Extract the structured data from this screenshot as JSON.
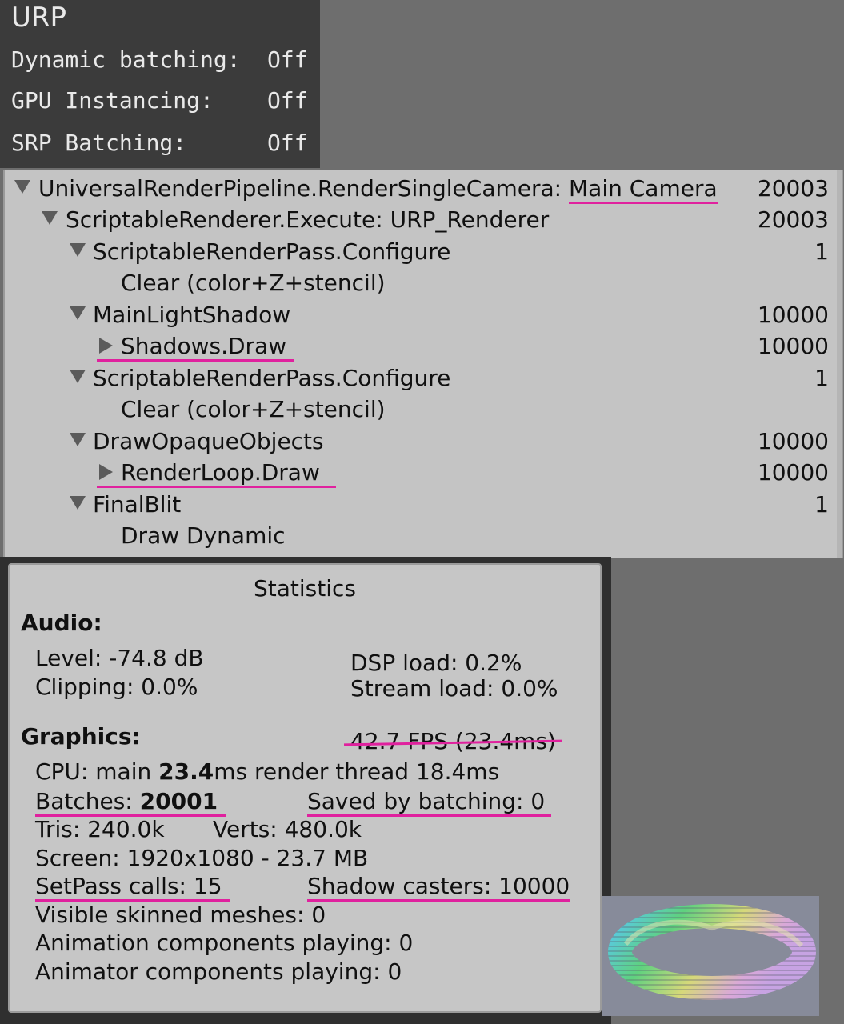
{
  "urp": {
    "title": "URP",
    "rows": [
      {
        "label": "Dynamic batching:",
        "value": "Off"
      },
      {
        "label": "GPU Instancing:",
        "value": "Off"
      },
      {
        "label": "SRP Batching:",
        "value": "Off"
      }
    ]
  },
  "tree": {
    "rows": [
      {
        "arrow": "down",
        "label": "UniversalRenderPipeline.RenderSingleCamera: ",
        "label_hl": "Main Camera",
        "count": "20003"
      },
      {
        "arrow": "down",
        "label": "ScriptableRenderer.Execute: URP_Renderer",
        "count": "20003"
      },
      {
        "arrow": "down",
        "label": "ScriptableRenderPass.Configure",
        "count": "1"
      },
      {
        "arrow": "none",
        "label": "Clear (color+Z+stencil)",
        "count": ""
      },
      {
        "arrow": "down",
        "label": "MainLightShadow",
        "count": "10000"
      },
      {
        "arrow": "right",
        "label": "Shadows.Draw",
        "count": "10000"
      },
      {
        "arrow": "down",
        "label": "ScriptableRenderPass.Configure",
        "count": "1"
      },
      {
        "arrow": "none",
        "label": "Clear (color+Z+stencil)",
        "count": ""
      },
      {
        "arrow": "down",
        "label": "DrawOpaqueObjects",
        "count": "10000"
      },
      {
        "arrow": "right",
        "label": "RenderLoop.Draw",
        "count": "10000"
      },
      {
        "arrow": "down",
        "label": "FinalBlit",
        "count": "1"
      },
      {
        "arrow": "none",
        "label": "Draw Dynamic",
        "count": ""
      }
    ]
  },
  "stats": {
    "title": "Statistics",
    "audio": {
      "heading": "Audio:",
      "level": "Level: -74.8 dB",
      "clipping": "Clipping: 0.0%",
      "dsp": "DSP load: 0.2%",
      "stream": "Stream load: 0.0%"
    },
    "graphics": {
      "heading": "Graphics:",
      "fps": "42.7 FPS (23.4ms)",
      "cpu_prefix": "CPU: main ",
      "cpu_main": "23.4",
      "cpu_suffix": "ms  render thread 18.4ms",
      "batches_prefix": "Batches: ",
      "batches_value": "20001",
      "saved": "Saved by batching: 0",
      "tris": "Tris: 240.0k",
      "verts": "Verts: 480.0k",
      "screen": "Screen: 1920x1080 - 23.7 MB",
      "setpass": "SetPass calls: 15",
      "shadow_casters": "Shadow casters: 10000",
      "skinned": "Visible skinned meshes: 0",
      "animation": "Animation components playing: 0",
      "animator": "Animator components playing: 0"
    }
  },
  "colors": {
    "highlight": "#e0219e",
    "panel_bg": "#c6c6c6",
    "header_bg": "#3b3b3b"
  }
}
